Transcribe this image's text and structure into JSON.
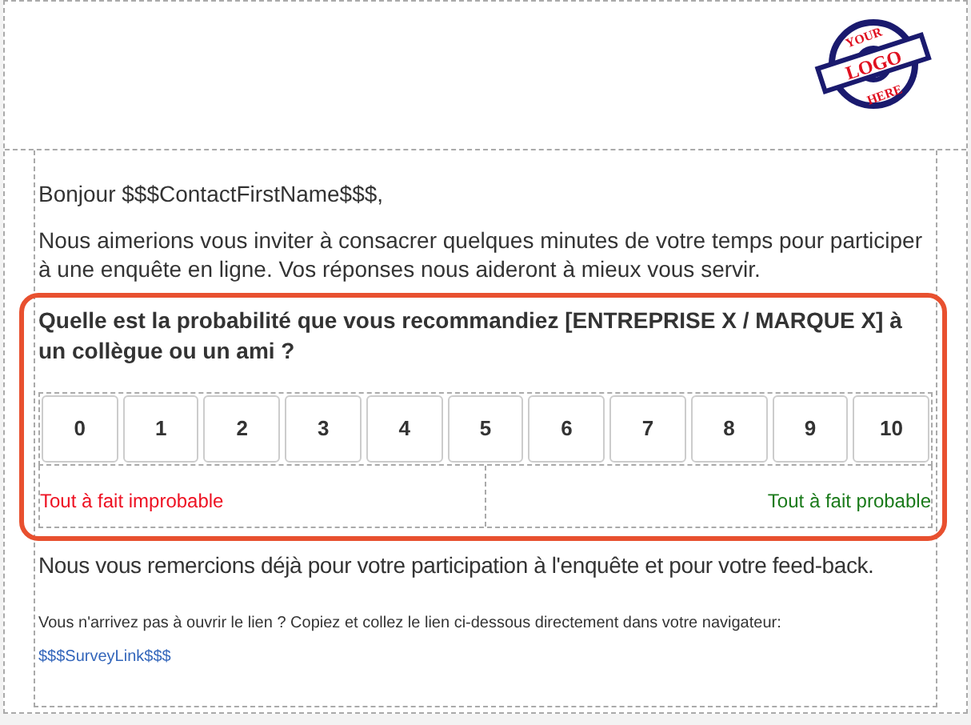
{
  "logo": {
    "top": "YOUR",
    "middle": "LOGO",
    "bottom": "HERE"
  },
  "greeting": "Bonjour $$$ContactFirstName$$$,",
  "intro": "Nous aimerions vous inviter à consacrer quelques minutes de votre temps pour participer à une enquête en ligne. Vos réponses nous aideront à mieux vous servir.",
  "question": {
    "text": "Quelle est la probabilité que vous recommandiez [ENTREPRISE X / MARQUE X] à un collègue ou un ami ?",
    "scale": [
      "0",
      "1",
      "2",
      "3",
      "4",
      "5",
      "6",
      "7",
      "8",
      "9",
      "10"
    ],
    "low_label": "Tout à fait improbable",
    "high_label": "Tout à fait probable"
  },
  "thanks": "Nous vous remercions déjà pour votre participation à l'enquête et pour votre feed-back.",
  "link_hint": "Vous n'arrivez pas à ouvrir le lien ? Copiez et collez le lien ci-dessous directement dans votre navigateur:",
  "survey_link": "$$$SurveyLink$$$"
}
